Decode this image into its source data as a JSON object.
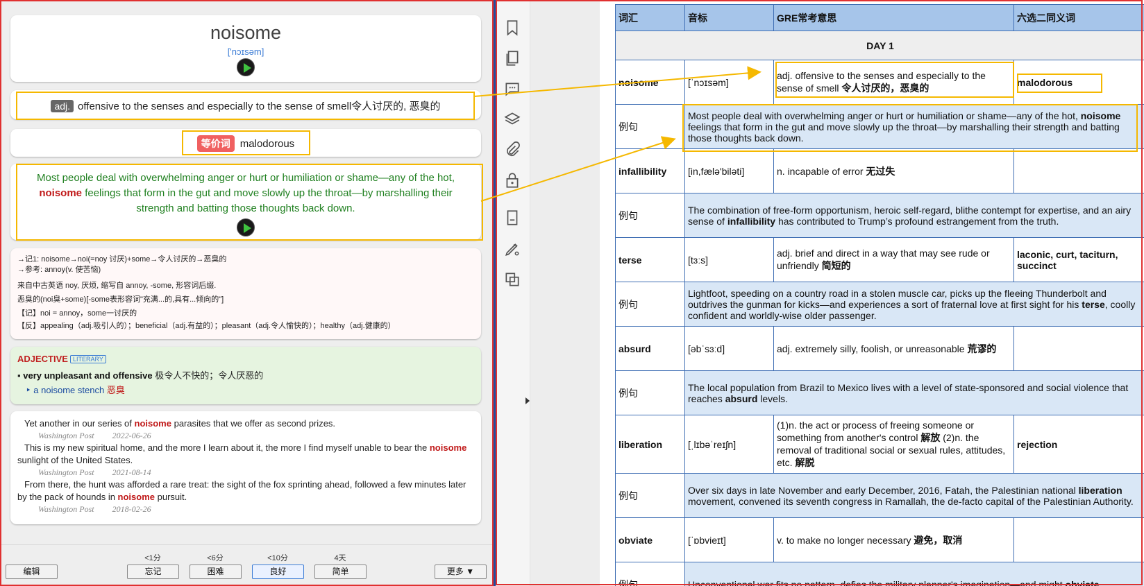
{
  "card": {
    "word": "noisome",
    "ipa": "['nɔɪsəm]",
    "pos": "adj.",
    "definition": "offensive to the senses and especially to the sense of smell令人讨厌的, 恶臭的",
    "synonym_tag": "等价词",
    "synonym": "malodorous",
    "example_before": "Most people deal with overwhelming anger or hurt or humiliation or shame—any of the hot, ",
    "example_keyword": "noisome",
    "example_after": " feelings that form in the gut and move slowly up the throat—by marshalling their strength and batting those thoughts back down."
  },
  "notes": [
    "→记1: noisome→noi(=noy 讨厌)+some→令人讨厌的→恶臭的",
    "→参考: annoy(v. 使苦恼)",
    "来自中古英语 noy, 厌烦, 缩写自 annoy, -some, 形容词后缀.",
    "恶臭的(noi臭+some)[-some表形容词\"充满...的,具有...倾向的\"]",
    "【记】noi = annoy，some一讨厌的",
    "【反】appealing（adj.吸引人的）；beneficial（adj.有益的）；pleasant（adj.令人愉快的）；healthy（adj.健康的）"
  ],
  "dictionary": {
    "pos": "ADJECTIVE",
    "register": "LITERARY",
    "sense_en": "very unpleasant and offensive",
    "sense_cn": "极令人不快的；令人厌恶的",
    "example_en": "a noisome stench",
    "example_cn": "恶臭"
  },
  "quotes": [
    {
      "before": "Yet another in our series of ",
      "keyword": "noisome",
      "after": " parasites that we offer as second prizes.",
      "source": "Washington Post",
      "date": "2022-06-26"
    },
    {
      "before": "This is my new spiritual home, and the more I learn about it, the more I find myself unable to bear the ",
      "keyword": "noisome",
      "after": " sunlight of the United States.",
      "source": "Washington Post",
      "date": "2021-08-14"
    },
    {
      "before": "From there, the hunt was afforded a rare treat: the sight of the fox sprinting ahead, followed a few minutes later by the pack of hounds in ",
      "keyword": "noisome",
      "after": " pursuit.",
      "source": "Washington Post",
      "date": "2018-02-26"
    }
  ],
  "bottom_bar": {
    "edit": "编辑",
    "more": "更多 ▼",
    "intervals": [
      "<1分",
      "<6分",
      "<10分",
      "4天"
    ],
    "answers": [
      "忘记",
      "困难",
      "良好",
      "简单"
    ]
  },
  "table": {
    "headers": [
      "词汇",
      "音标",
      "GRE常考意思",
      "六选二同义词"
    ],
    "day_label": "DAY 1",
    "example_label": "例句",
    "entries": [
      {
        "word": "noisome",
        "ipa": "[ˈnɔɪsəm]",
        "meaning_en": "adj. offensive to the senses and especially to the sense of smell ",
        "meaning_cn": "令人讨厌的，恶臭的",
        "synonyms": "malodorous",
        "ex_before": "Most people deal with overwhelming anger or hurt or humiliation or shame—any of the hot, ",
        "ex_kw": "noisome",
        "ex_after": " feelings that form in the gut and move slowly up the throat—by marshalling their strength and batting those thoughts back down."
      },
      {
        "word": "infallibility",
        "ipa": "[in,fælə'biləti]",
        "meaning_en": "n. incapable of error ",
        "meaning_cn": "无过失",
        "synonyms": "",
        "ex_before": "The combination of free-form opportunism, heroic self-regard, blithe contempt for expertise, and an airy sense of ",
        "ex_kw": "infallibility",
        "ex_after": " has contributed to Trump’s profound estrangement from the truth."
      },
      {
        "word": "terse",
        "ipa": "[tɜːs]",
        "meaning_en": "adj. brief and direct in a way that may see rude or unfriendly ",
        "meaning_cn": "简短的",
        "synonyms": "laconic, curt, taciturn, succinct",
        "ex_before": "Lightfoot, speeding on a country road in a stolen muscle car, picks up the fleeing Thunderbolt and outdrives the gunman for kicks—and experiences a sort of fraternal love at first sight for his ",
        "ex_kw": "terse",
        "ex_after": ", coolly confident and worldly-wise older passenger."
      },
      {
        "word": "absurd",
        "ipa": "[əbˈsɜːd]",
        "meaning_en": "adj. extremely silly, foolish, or unreasonable ",
        "meaning_cn": "荒谬的",
        "synonyms": "",
        "ex_before": "The local population from Brazil to Mexico lives with a level of state-sponsored and social violence that reaches ",
        "ex_kw": "absurd",
        "ex_after": " levels."
      },
      {
        "word": "liberation",
        "ipa": "[ˌlɪbəˈreɪʃn]",
        "meaning_en": "(1)n. the act or process of freeing someone or something from another's control ",
        "meaning_cn": "解放",
        "meaning_en2": " (2)n. the removal of traditional social or sexual rules, attitudes, etc. ",
        "meaning_cn2": "解脱",
        "synonyms": "rejection",
        "ex_before": "Over six days in late November and early December, 2016, Fatah, the Palestinian national ",
        "ex_kw": "liberation",
        "ex_after": " movement, convened its seventh congress in Ramallah, the de-facto capital of the Palestinian Authority."
      },
      {
        "word": "obviate",
        "ipa": "[ˈɒbvieɪt]",
        "meaning_en": "v. to make no longer necessary ",
        "meaning_cn": "避免，取消",
        "synonyms": "",
        "ex_before": "Unconventional war fits no pattern, defies the military planner's imagination—and might ",
        "ex_kw": "obviate",
        "ex_after": ""
      }
    ]
  },
  "icons": [
    "bookmark-icon",
    "pages-icon",
    "comment-icon",
    "layers-icon",
    "attachment-icon",
    "lock-icon",
    "document-icon",
    "pen-icon",
    "copy-icon"
  ],
  "colors": {
    "highlight": "#f5b800",
    "accent_red": "#c01818",
    "example_green": "#208020",
    "table_header": "#a6c5ea",
    "table_border": "#3d6db3",
    "example_row": "#d9e7f6"
  }
}
